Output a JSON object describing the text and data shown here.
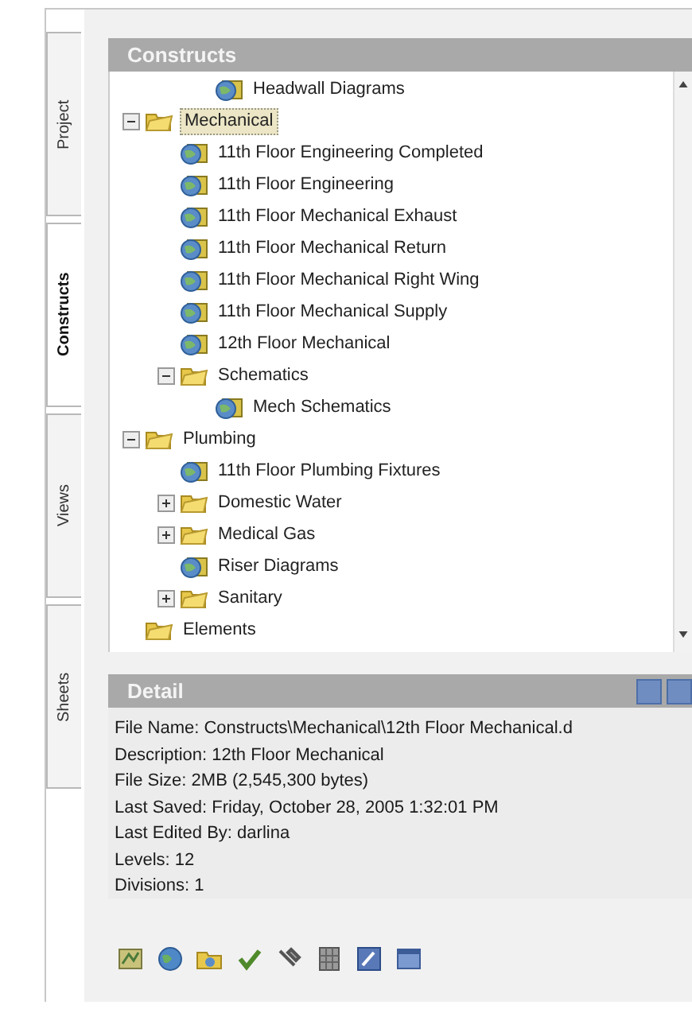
{
  "side_tabs": [
    {
      "label": "Project",
      "selected": false
    },
    {
      "label": "Constructs",
      "selected": true
    },
    {
      "label": "Views",
      "selected": false
    },
    {
      "label": "Sheets",
      "selected": false
    }
  ],
  "tree_panel": {
    "title": "Constructs",
    "items": [
      {
        "kind": "offscreen",
        "children": [
          {
            "kind": "offscreen",
            "children": [
              {
                "kind": "drawing",
                "label": "Headwall Diagrams",
                "selected": false
              }
            ]
          }
        ]
      },
      {
        "kind": "folder",
        "label": "Mechanical",
        "selected": true,
        "expanded": true,
        "children": [
          {
            "kind": "drawing",
            "label": "11th Floor Engineering Completed",
            "selected": false
          },
          {
            "kind": "drawing",
            "label": "11th Floor Engineering",
            "selected": false
          },
          {
            "kind": "drawing",
            "label": "11th Floor Mechanical Exhaust",
            "selected": false
          },
          {
            "kind": "drawing",
            "label": "11th Floor Mechanical Return",
            "selected": false
          },
          {
            "kind": "drawing",
            "label": "11th Floor Mechanical Right Wing",
            "selected": false
          },
          {
            "kind": "drawing",
            "label": "11th Floor Mechanical Supply",
            "selected": false
          },
          {
            "kind": "drawing",
            "label": "12th Floor Mechanical",
            "selected": false
          },
          {
            "kind": "folder",
            "label": "Schematics",
            "selected": false,
            "expanded": true,
            "children": [
              {
                "kind": "drawing",
                "label": "Mech Schematics",
                "selected": false
              }
            ]
          }
        ]
      },
      {
        "kind": "folder",
        "label": "Plumbing",
        "selected": false,
        "expanded": true,
        "children": [
          {
            "kind": "drawing",
            "label": "11th Floor Plumbing Fixtures",
            "selected": false
          },
          {
            "kind": "folder",
            "label": "Domestic Water",
            "selected": false,
            "expanded": false
          },
          {
            "kind": "folder",
            "label": "Medical Gas",
            "selected": false,
            "expanded": false
          },
          {
            "kind": "drawing",
            "label": "Riser Diagrams",
            "selected": false
          },
          {
            "kind": "folder",
            "label": "Sanitary",
            "selected": false,
            "expanded": false
          }
        ]
      },
      {
        "kind": "folder",
        "label": "Elements",
        "selected": false
      }
    ]
  },
  "detail_panel": {
    "title": "Detail",
    "lines": [
      "File Name: Constructs\\Mechanical\\12th Floor Mechanical.d",
      "Description: 12th Floor Mechanical",
      "File Size: 2MB (2,545,300 bytes)",
      "Last Saved: Friday, October 28, 2005 1:32:01 PM",
      "Last Edited By: darlina",
      "Levels: 12",
      "Divisions: 1"
    ]
  },
  "toolbar": [
    {
      "kind": "map"
    },
    {
      "kind": "globe"
    },
    {
      "kind": "folder"
    },
    {
      "kind": "check"
    },
    {
      "kind": "tool"
    },
    {
      "kind": "grid"
    },
    {
      "kind": "pencil"
    },
    {
      "kind": "window"
    }
  ]
}
